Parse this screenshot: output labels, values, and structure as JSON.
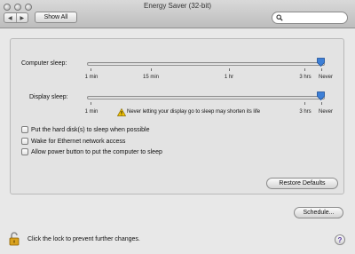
{
  "window": {
    "title": "Energy Saver (32-bit)"
  },
  "toolbar": {
    "back_icon": "back-arrow-icon",
    "forward_icon": "forward-arrow-icon",
    "show_all_label": "Show All",
    "search": {
      "value": "",
      "placeholder": "",
      "icon": "search-icon"
    }
  },
  "computer_sleep": {
    "label": "Computer sleep:",
    "value": "Never",
    "ticks": [
      "1 min",
      "15 min",
      "1 hr",
      "3 hrs",
      "Never"
    ]
  },
  "display_sleep": {
    "label": "Display sleep:",
    "value": "Never",
    "ticks": [
      "1 min",
      "3 hrs",
      "Never"
    ],
    "warning_icon": "warning-icon",
    "warning_text": "Never letting your display go to sleep may shorten its life"
  },
  "options": [
    {
      "label": "Put the hard disk(s) to sleep when possible",
      "checked": false
    },
    {
      "label": "Wake for Ethernet network access",
      "checked": false
    },
    {
      "label": "Allow power button to put the computer to sleep",
      "checked": false
    }
  ],
  "buttons": {
    "restore_defaults": "Restore Defaults",
    "schedule": "Schedule..."
  },
  "footer": {
    "lock_icon": "lock-open-icon",
    "lock_text": "Click the lock to prevent further changes.",
    "help_label": "?"
  },
  "colors": {
    "thumb_blue": "#3d7fd6",
    "warning_yellow": "#f2c200",
    "help_purple": "#5a3da2"
  }
}
